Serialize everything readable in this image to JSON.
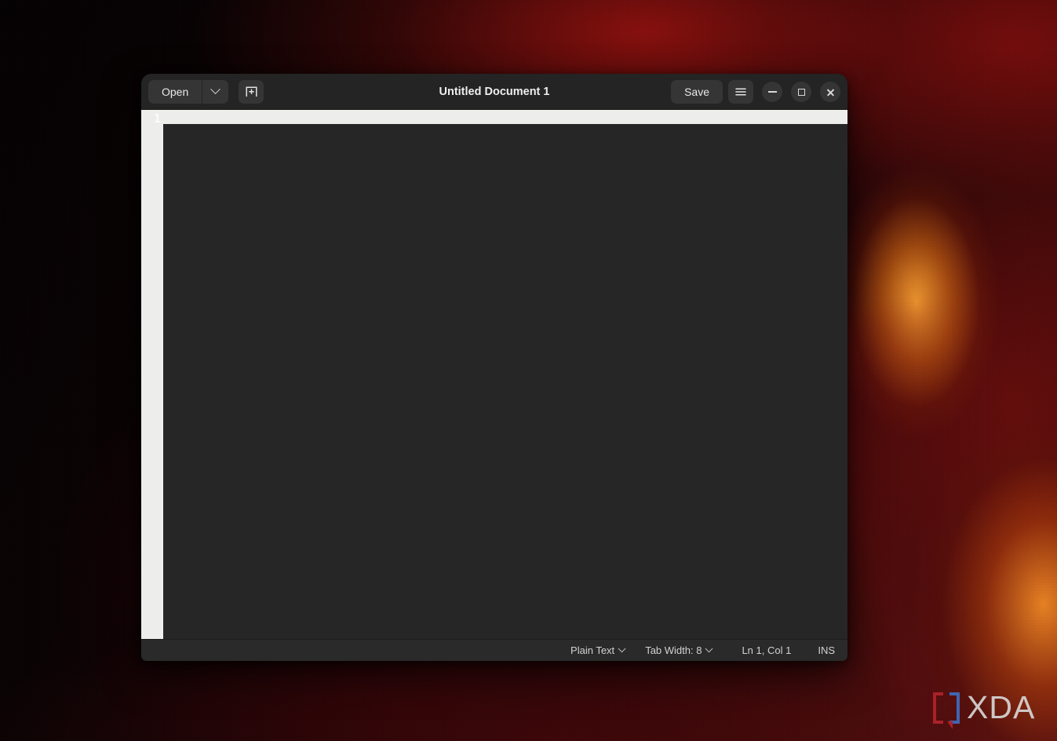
{
  "desktop": {
    "wallpaper_name": "abstract-red-ember-wallpaper",
    "watermark": {
      "text": "XDA",
      "icon": "xda-bracket-icon",
      "bracket_left_color": "#b4242e",
      "bracket_right_color": "#3f6fc4",
      "text_color": "#d9d9da"
    }
  },
  "window": {
    "title": "Untitled Document 1",
    "headerbar": {
      "open_button": {
        "label": "Open",
        "dropdown_icon": "chevron-down-icon"
      },
      "new_document_button": {
        "icon": "new-document-icon",
        "label": ""
      },
      "save_button": {
        "label": "Save"
      },
      "menu_button": {
        "icon": "hamburger-menu-icon",
        "label": ""
      },
      "window_controls": {
        "minimize": {
          "icon": "minimize-icon",
          "label": ""
        },
        "maximize": {
          "icon": "maximize-icon",
          "label": ""
        },
        "close": {
          "icon": "close-icon",
          "label": ""
        }
      }
    },
    "editor": {
      "line_numbers": [
        "1"
      ],
      "content": "",
      "gutter_bg": "#ededeb",
      "text_bg": "#262626",
      "line_number_color": "#fbfbfb"
    },
    "statusbar": {
      "language": {
        "label": "Plain Text",
        "icon": "chevron-down-icon"
      },
      "tab_width": {
        "label": "Tab Width: 8",
        "icon": "chevron-down-icon"
      },
      "position": "Ln 1, Col 1",
      "insert_mode": "INS"
    }
  }
}
